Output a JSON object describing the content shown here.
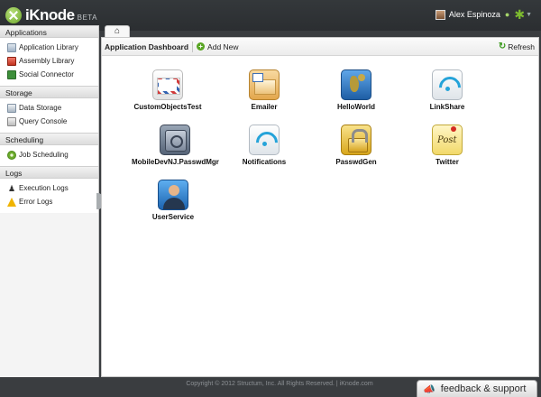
{
  "brand": {
    "name": "iKnode",
    "badge": "BETA"
  },
  "user": {
    "name": "Alex Espinoza"
  },
  "sidebar": {
    "sections": [
      {
        "title": "Applications",
        "items": [
          {
            "label": "Application Library",
            "icon": "application-library-icon"
          },
          {
            "label": "Assembly Library",
            "icon": "assembly-library-icon"
          },
          {
            "label": "Social Connector",
            "icon": "social-connector-icon"
          }
        ]
      },
      {
        "title": "Storage",
        "items": [
          {
            "label": "Data Storage",
            "icon": "data-storage-icon"
          },
          {
            "label": "Query Console",
            "icon": "query-console-icon"
          }
        ]
      },
      {
        "title": "Scheduling",
        "items": [
          {
            "label": "Job Scheduling",
            "icon": "job-scheduling-icon"
          }
        ]
      },
      {
        "title": "Logs",
        "items": [
          {
            "label": "Execution Logs",
            "icon": "execution-logs-icon"
          },
          {
            "label": "Error Logs",
            "icon": "warning-icon"
          }
        ]
      }
    ]
  },
  "tabs": {
    "home_icon": "home-icon"
  },
  "toolbar": {
    "title": "Application Dashboard",
    "add_label": "Add New",
    "refresh_label": "Refresh"
  },
  "apps": [
    {
      "label": "CustomObjectsTest",
      "icon": "mail-envelope-icon"
    },
    {
      "label": "Emailer",
      "icon": "emailer-envelope-icon"
    },
    {
      "label": "HelloWorld",
      "icon": "globe-icon"
    },
    {
      "label": "LinkShare",
      "icon": "wifi-icon"
    },
    {
      "label": "MobileDevNJ.PasswdMgr",
      "icon": "safe-icon"
    },
    {
      "label": "Notifications",
      "icon": "wifi-icon"
    },
    {
      "label": "PasswdGen",
      "icon": "padlock-icon"
    },
    {
      "label": "Twitter",
      "icon": "post-it-icon",
      "icon_text": "Post"
    },
    {
      "label": "UserService",
      "icon": "user-icon"
    }
  ],
  "footer": {
    "copyright": "Copyright © 2012 Structum, Inc. All Rights Reserved. | iKnode.com"
  },
  "feedback": {
    "label": "feedback & support"
  }
}
